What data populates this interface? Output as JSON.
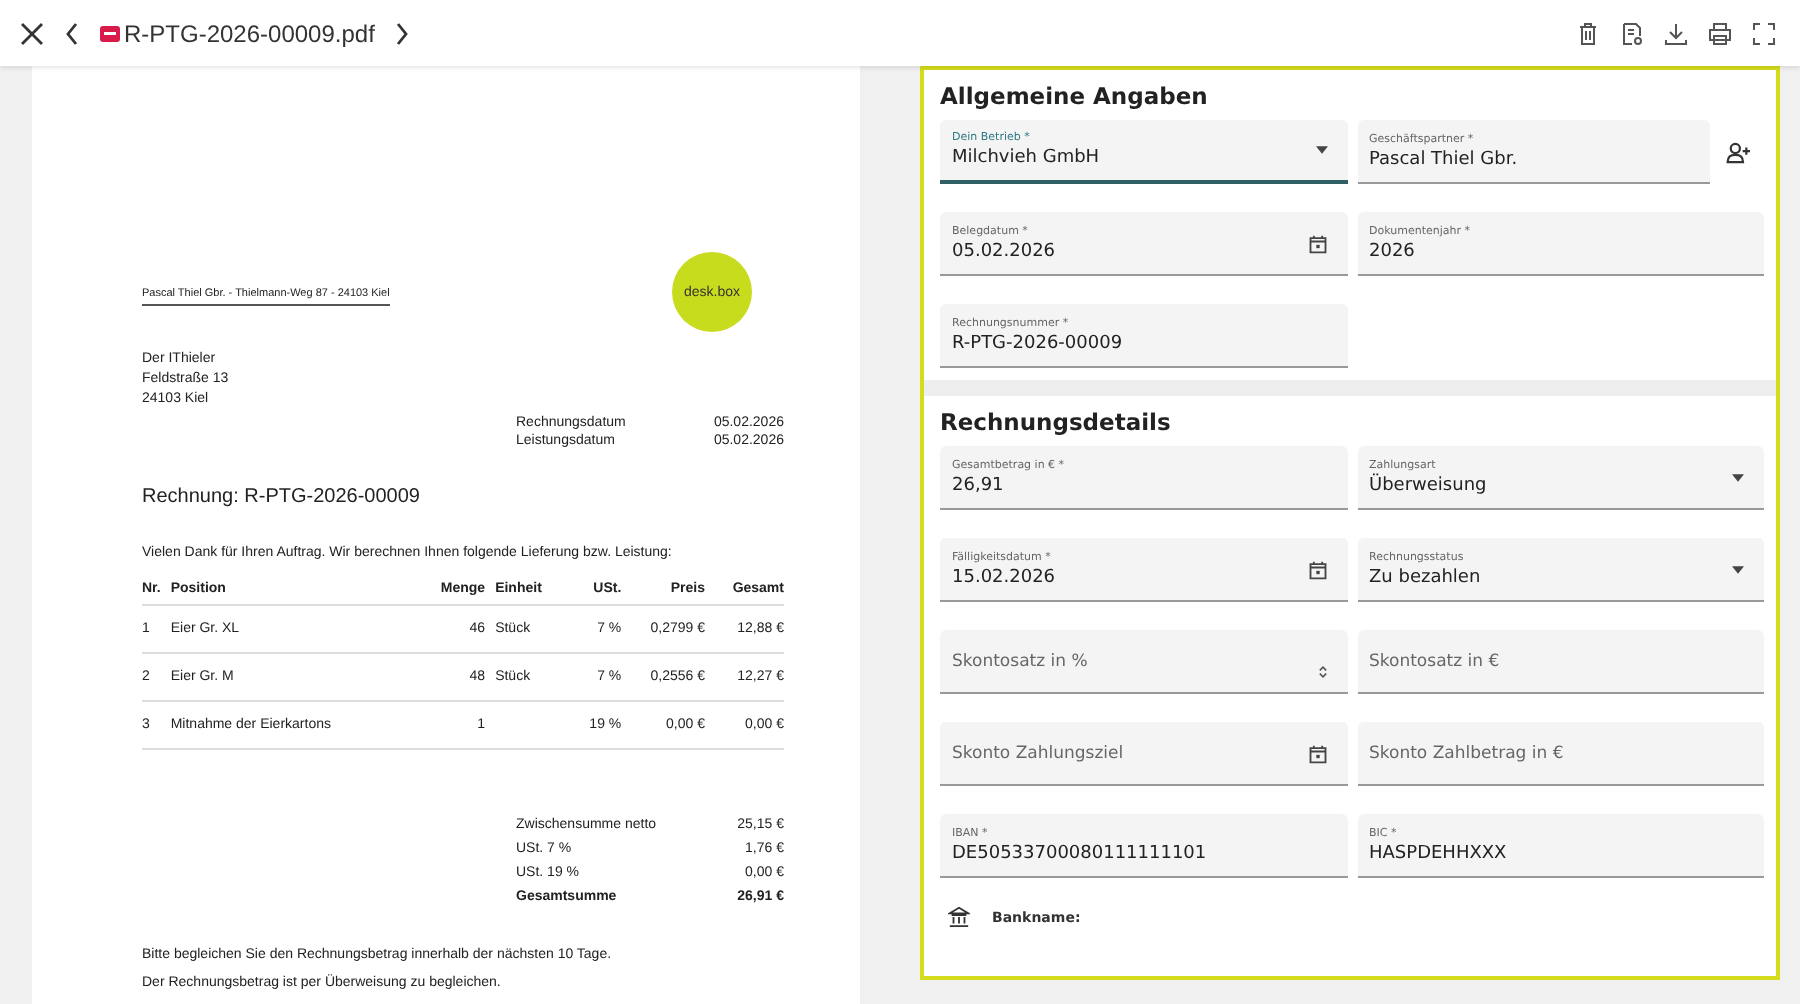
{
  "toolbar": {
    "file_name": "R-PTG-2026-00009.pdf"
  },
  "document": {
    "sender_line": "Pascal Thiel Gbr. - Thielmann-Weg 87 - 24103 Kiel",
    "logo_text": "desk.box",
    "address": [
      "Der IThieler",
      "Feldstraße   13",
      "24103 Kiel"
    ],
    "dates": [
      {
        "label": "Rechnungsdatum",
        "value": "05.02.2026"
      },
      {
        "label": "Leistungsdatum",
        "value": "05.02.2026"
      }
    ],
    "title": "Rechnung: R-PTG-2026-00009",
    "intro": "Vielen Dank für Ihren Auftrag. Wir berechnen Ihnen folgende Lieferung bzw. Leistung:",
    "columns": [
      "Nr.",
      "Position",
      "Menge",
      "Einheit",
      "USt.",
      "Preis",
      "Gesamt"
    ],
    "rows": [
      [
        "1",
        "Eier Gr. XL",
        "46",
        "Stück",
        "7 %",
        "0,2799 €",
        "12,88 €"
      ],
      [
        "2",
        "Eier Gr. M",
        "48",
        "Stück",
        "7 %",
        "0,2556 €",
        "12,27 €"
      ],
      [
        "3",
        "Mitnahme der Eierkartons",
        "1",
        "",
        "19 %",
        "0,00 €",
        "0,00 €"
      ]
    ],
    "totals": [
      {
        "label": "Zwischensumme netto",
        "value": "25,15 €",
        "bold": false
      },
      {
        "label": "USt. 7 %",
        "value": "1,76 €",
        "bold": false
      },
      {
        "label": "USt. 19 %",
        "value": "0,00 €",
        "bold": false
      },
      {
        "label": "Gesamtsumme",
        "value": "26,91 €",
        "bold": true
      }
    ],
    "footer": [
      "Bitte begleichen Sie den Rechnungsbetrag innerhalb der nächsten 10 Tage.",
      "Der Rechnungsbetrag ist per Überweisung zu begleichen."
    ]
  },
  "sections": [
    {
      "title": "Allgemeine Angaben",
      "rows": [
        [
          {
            "kind": "select",
            "label": "Dein Betrieb *",
            "value": "Milchvieh GmbH",
            "focused": true
          },
          {
            "kind": "partner",
            "label": "Geschäftspartner *",
            "value": "Pascal Thiel Gbr.",
            "focused": false
          }
        ],
        [
          {
            "kind": "date",
            "label": "Belegdatum *",
            "value": "05.02.2026",
            "focused": false
          },
          {
            "kind": "text",
            "label": "Dokumentenjahr *",
            "value": "2026",
            "focused": false
          }
        ],
        [
          {
            "kind": "text",
            "label": "Rechnungsnummer *",
            "value": "R-PTG-2026-00009",
            "focused": false
          }
        ]
      ]
    },
    {
      "title": "Rechnungsdetails",
      "rows": [
        [
          {
            "kind": "text",
            "label": "Gesamtbetrag in € *",
            "value": "26,91",
            "focused": false
          },
          {
            "kind": "select",
            "label": "Zahlungsart",
            "value": "Überweisung",
            "focused": false
          }
        ],
        [
          {
            "kind": "date",
            "label": "Fälligkeitsdatum *",
            "value": "15.02.2026",
            "focused": false
          },
          {
            "kind": "select",
            "label": "Rechnungsstatus",
            "value": "Zu bezahlen",
            "focused": false
          }
        ],
        [
          {
            "kind": "number",
            "label": "Skontosatz in %",
            "focused": false
          },
          {
            "kind": "text",
            "label": "Skontosatz in €",
            "focused": false
          }
        ],
        [
          {
            "kind": "date",
            "label": "Skonto Zahlungsziel",
            "focused": false
          },
          {
            "kind": "text",
            "label": "Skonto Zahlbetrag in €",
            "focused": false
          }
        ],
        [
          {
            "kind": "text",
            "label": "IBAN *",
            "value": "DE50533700080111111101",
            "focused": false
          },
          {
            "kind": "text",
            "label": "BIC *",
            "value": "HASPDEHHXXX",
            "focused": false
          }
        ]
      ],
      "bank_label": "Bankname:"
    }
  ]
}
